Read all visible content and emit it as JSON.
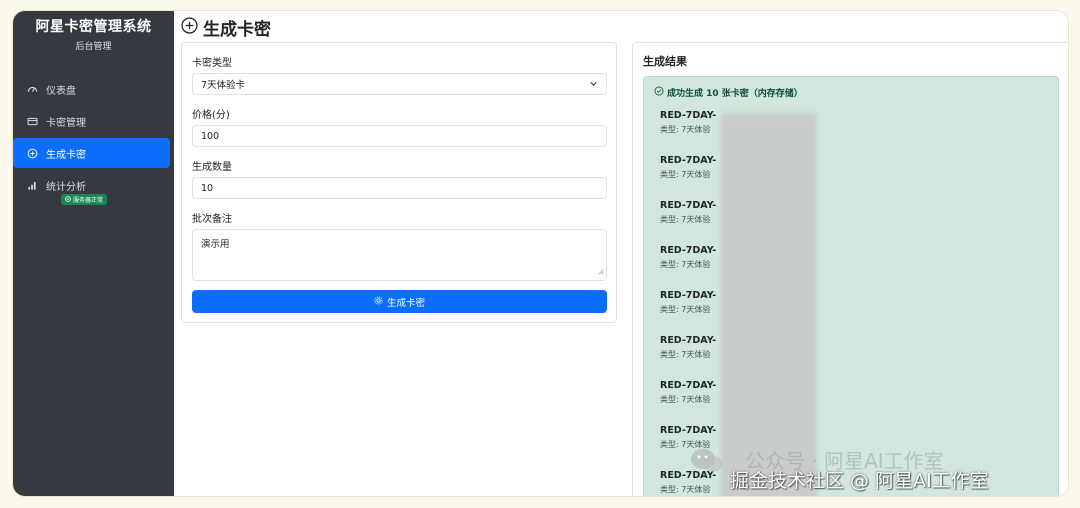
{
  "sidebar": {
    "title": "阿星卡密管理系统",
    "subtitle": "后台管理",
    "items": [
      {
        "label": "仪表盘",
        "icon": "dashboard-icon"
      },
      {
        "label": "卡密管理",
        "icon": "card-icon"
      },
      {
        "label": "生成卡密",
        "icon": "plus-circle-icon",
        "active": true
      },
      {
        "label": "统计分析",
        "icon": "bar-chart-icon"
      }
    ],
    "status_badge": "服务器正常"
  },
  "page": {
    "title": "生成卡密"
  },
  "form": {
    "type_label": "卡密类型",
    "type_value": "7天体验卡",
    "price_label": "价格(分)",
    "price_value": "100",
    "count_label": "生成数量",
    "count_value": "10",
    "note_label": "批次备注",
    "note_value": "演示用",
    "submit_label": "生成卡密"
  },
  "result": {
    "title": "生成结果",
    "success_message": "成功生成 10 张卡密（内存存储）",
    "cards": [
      {
        "code": "RED-7DAY-",
        "type": "类型: 7天体验"
      },
      {
        "code": "RED-7DAY-",
        "type": "类型: 7天体验"
      },
      {
        "code": "RED-7DAY-",
        "type": "类型: 7天体验"
      },
      {
        "code": "RED-7DAY-",
        "type": "类型: 7天体验"
      },
      {
        "code": "RED-7DAY-",
        "type": "类型: 7天体验"
      },
      {
        "code": "RED-7DAY-",
        "type": "类型: 7天体验"
      },
      {
        "code": "RED-7DAY-",
        "type": "类型: 7天体验"
      },
      {
        "code": "RED-7DAY-",
        "type": "类型: 7天体验"
      },
      {
        "code": "RED-7DAY-",
        "type": "类型: 7天体验"
      }
    ]
  },
  "watermark": {
    "line1": "公众号 · 阿星AI工作室",
    "line2": "掘金技术社区 @ 阿星AI工作室"
  },
  "colors": {
    "sidebar_bg": "#343a40",
    "primary": "#0d6efd",
    "success_bg": "#d1e7dd",
    "success_text": "#0f5132",
    "badge": "#198754"
  }
}
